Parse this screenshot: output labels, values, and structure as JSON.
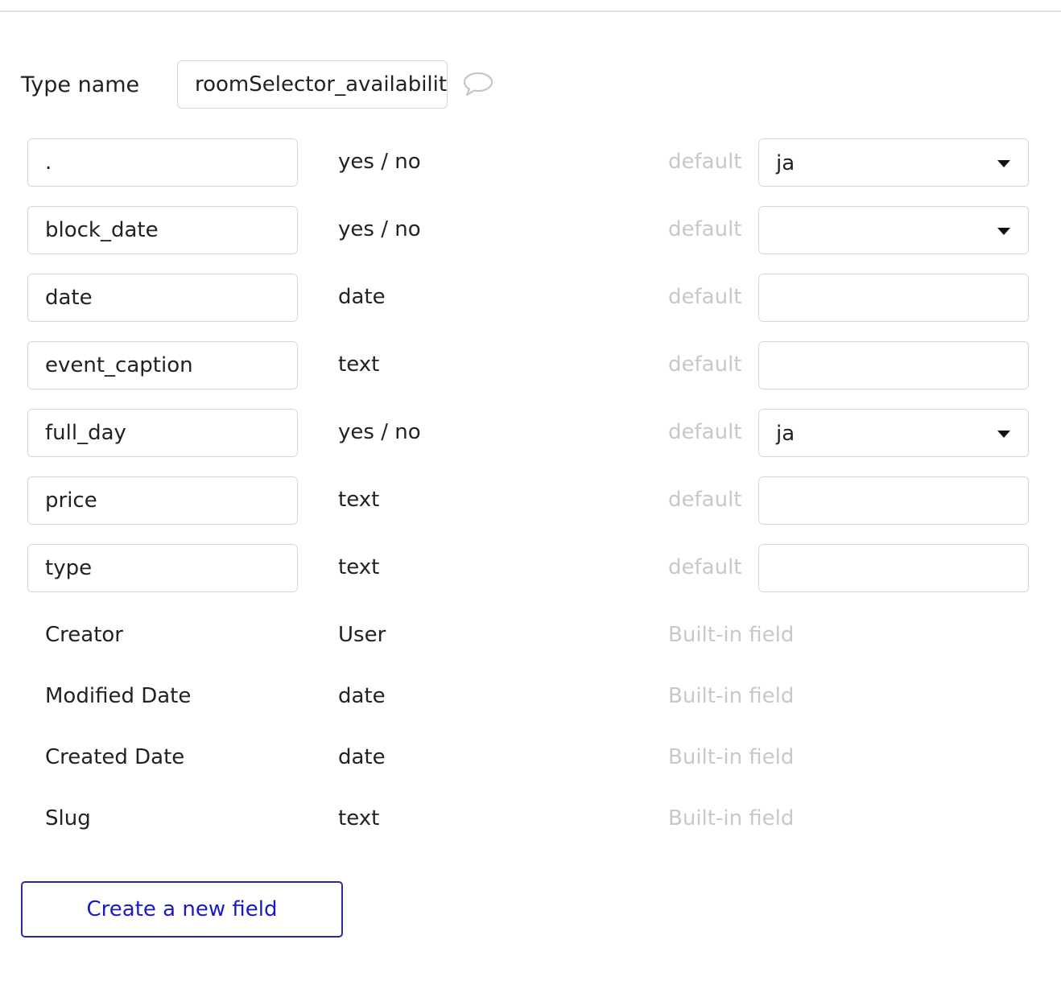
{
  "type_name": {
    "label": "Type name",
    "value": "roomSelector_availability"
  },
  "fields": [
    {
      "name": ".",
      "type": "yes / no",
      "default_label": "default",
      "default_kind": "select",
      "default_value": "ja"
    },
    {
      "name": "block_date",
      "type": "yes / no",
      "default_label": "default",
      "default_kind": "select",
      "default_value": ""
    },
    {
      "name": "date",
      "type": "date",
      "default_label": "default",
      "default_kind": "input",
      "default_value": ""
    },
    {
      "name": "event_caption",
      "type": "text",
      "default_label": "default",
      "default_kind": "input",
      "default_value": ""
    },
    {
      "name": "full_day",
      "type": "yes / no",
      "default_label": "default",
      "default_kind": "select",
      "default_value": "ja"
    },
    {
      "name": "price",
      "type": "text",
      "default_label": "default",
      "default_kind": "input",
      "default_value": ""
    },
    {
      "name": "type",
      "type": "text",
      "default_label": "default",
      "default_kind": "input",
      "default_value": ""
    }
  ],
  "builtin_fields": [
    {
      "name": "Creator",
      "type": "User",
      "note": "Built-in field"
    },
    {
      "name": "Modified Date",
      "type": "date",
      "note": "Built-in field"
    },
    {
      "name": "Created Date",
      "type": "date",
      "note": "Built-in field"
    },
    {
      "name": "Slug",
      "type": "text",
      "note": "Built-in field"
    }
  ],
  "create_button_label": "Create a new field",
  "icons": {
    "comment": "comment-icon",
    "caret": "chevron-down-icon"
  },
  "colors": {
    "button_text": "#1a1ac0",
    "button_border": "#2a2aa5",
    "muted_text": "#c8c8c8",
    "border": "#d6d6d6"
  }
}
